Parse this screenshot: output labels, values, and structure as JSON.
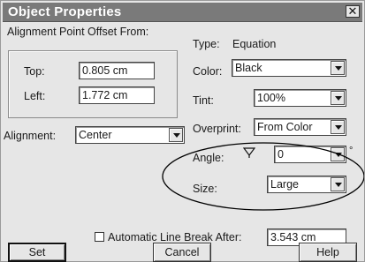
{
  "dialog": {
    "title": "Object Properties",
    "close_glyph": "✕"
  },
  "alignment_point": {
    "group_label": "Alignment Point Offset From:",
    "top_label": "Top:",
    "top_value": "0.805 cm",
    "left_label": "Left:",
    "left_value": "1.772 cm"
  },
  "alignment": {
    "label": "Alignment:",
    "value": "Center"
  },
  "type": {
    "label": "Type:",
    "value": "Equation"
  },
  "color": {
    "label": "Color:",
    "value": "Black"
  },
  "tint": {
    "label": "Tint:",
    "value": "100%"
  },
  "overprint": {
    "label": "Overprint:",
    "value": "From Color"
  },
  "angle": {
    "label": "Angle:",
    "icon": "angle-rotate-icon",
    "value": "0",
    "unit": "°"
  },
  "size": {
    "label": "Size:",
    "value": "Large"
  },
  "auto_line_break": {
    "label": "Automatic Line Break After:",
    "value": "3.543 cm",
    "checked": false
  },
  "buttons": {
    "set": "Set",
    "cancel": "Cancel",
    "help": "Help"
  },
  "annotation": {
    "shape": "ellipse",
    "color": "#000000",
    "target": "size"
  }
}
